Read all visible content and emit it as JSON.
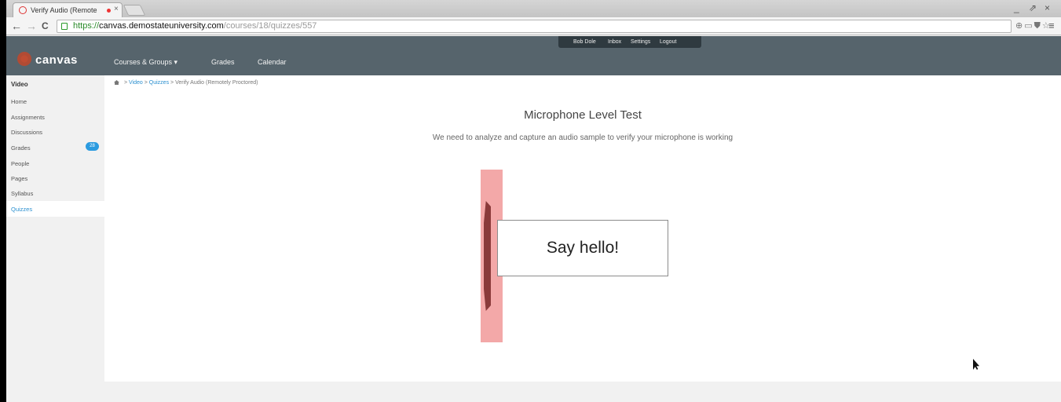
{
  "browser": {
    "tab_title": "Verify Audio (Remote",
    "url_scheme": "https://",
    "url_host": "canvas.demostateuniversity.com",
    "url_path": "/courses/18/quizzes/557",
    "tab_close": "×",
    "back": "←",
    "forward": "→",
    "reload": "C",
    "extensions": "⊕▭⛊☆",
    "menu": "≡",
    "window_minimize": "_",
    "window_restore": "⇗",
    "window_close": "×"
  },
  "header": {
    "logo": "canvas",
    "nav": [
      "Courses & Groups ▾",
      "Grades",
      "Calendar"
    ],
    "user_menu": [
      "Bob Dole",
      "Inbox",
      "Settings",
      "Logout"
    ]
  },
  "sidebar": {
    "course": "Video",
    "items": [
      "Home",
      "Assignments",
      "Discussions",
      "Grades",
      "People",
      "Pages",
      "Syllabus",
      "Quizzes"
    ],
    "grades_badge": "28"
  },
  "breadcrumb": [
    "Video",
    "Quizzes",
    "Verify Audio (Remotely Proctored)"
  ],
  "breadcrumb_sep": ">",
  "main": {
    "title": "Microphone Level Test",
    "subtitle": "We need to analyze and capture an audio sample to verify your microphone is working",
    "prompt": "Say hello!"
  },
  "colors": {
    "header_bg": "#56646c",
    "meter_bg": "#f3a8a8",
    "link": "#2a8fcf"
  }
}
